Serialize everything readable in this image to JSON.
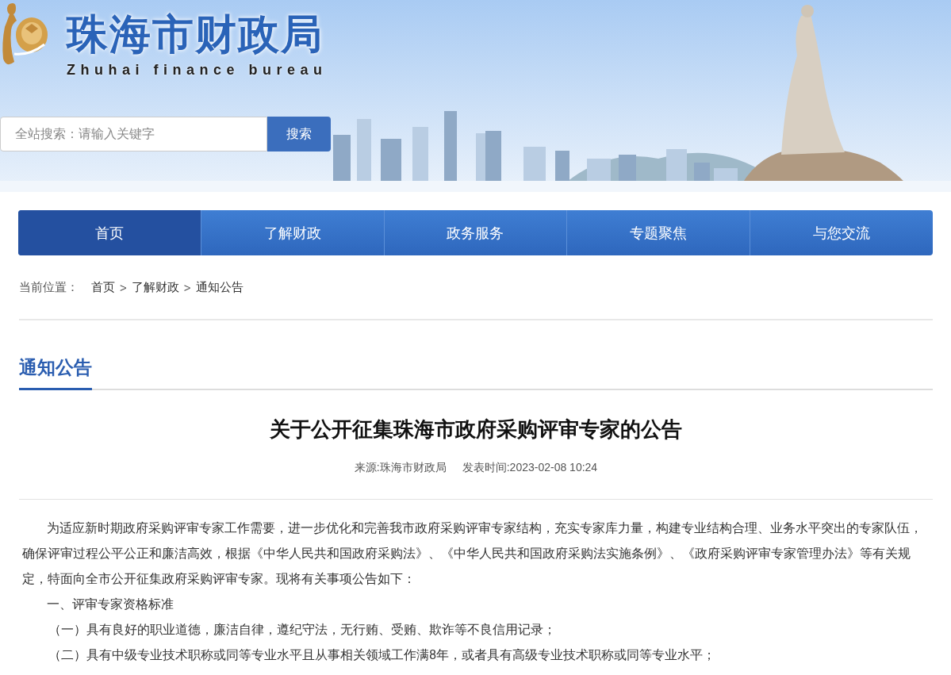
{
  "header": {
    "title": "珠海市财政局",
    "subtitle": "Zhuhai finance bureau",
    "search": {
      "placeholder": "全站搜索：请输入关键字",
      "button": "搜索"
    }
  },
  "nav": [
    {
      "label": "首页",
      "selected": true
    },
    {
      "label": "了解财政",
      "selected": false
    },
    {
      "label": "政务服务",
      "selected": false
    },
    {
      "label": "专题聚焦",
      "selected": false
    },
    {
      "label": "与您交流",
      "selected": false
    }
  ],
  "breadcrumb": {
    "label": "当前位置：",
    "items": [
      "首页",
      "了解财政",
      "通知公告"
    ],
    "separator": ">"
  },
  "section_title": "通知公告",
  "article": {
    "title": "关于公开征集珠海市政府采购评审专家的公告",
    "source": "来源:珠海市财政局",
    "date": "发表时间:2023-02-08 10:24",
    "paragraphs": [
      {
        "kind": "body",
        "text": "为适应新时期政府采购评审专家工作需要，进一步优化和完善我市政府采购评审专家结构，充实专家库力量，构建专业结构合理、业务水平突出的专家队伍，确保评审过程公平公正和廉洁高效，根据《中华人民共和国政府采购法》、《中华人民共和国政府采购法实施条例》、《政府采购评审专家管理办法》等有关规定，特面向全市公开征集政府采购评审专家。现将有关事项公告如下："
      },
      {
        "kind": "heading",
        "text": "一、评审专家资格标准"
      },
      {
        "kind": "item",
        "text": "（一）具有良好的职业道德，廉洁自律，遵纪守法，无行贿、受贿、欺诈等不良信用记录；"
      },
      {
        "kind": "item",
        "text": "（二）具有中级专业技术职称或同等专业水平且从事相关领域工作满8年，或者具有高级专业技术职称或同等专业水平；"
      }
    ]
  }
}
